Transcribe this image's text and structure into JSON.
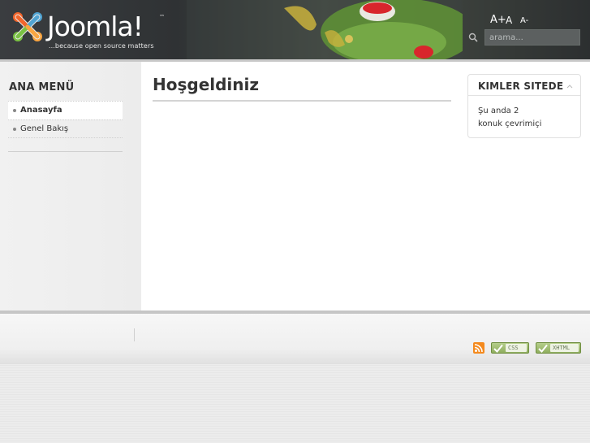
{
  "header": {
    "logo": {
      "wordmark": "Joomla!",
      "trademark": "™",
      "tagline": "...because open source matters"
    },
    "font_sizer": {
      "larger": "A+",
      "normal": "A",
      "smaller": "A-"
    },
    "search": {
      "placeholder": "arama...",
      "icon": "search-icon"
    }
  },
  "sidebar": {
    "title": "ANA MENÜ",
    "items": [
      {
        "label": "Anasayfa",
        "active": true
      },
      {
        "label": "Genel Bakış",
        "active": false
      }
    ]
  },
  "main": {
    "title": "Hoşgeldiniz"
  },
  "who_online": {
    "title": "KIMLER SITEDE",
    "line1": "Şu anda 2",
    "line2": "konuk çevrimiçi"
  },
  "footer": {
    "badges": {
      "rss": "rss-icon",
      "css": "CSS",
      "xhtml": "XHTML"
    }
  },
  "colors": {
    "header_bg": "#2f3234",
    "frog_green": "#6aa03a",
    "accent_red": "#d8262c",
    "badge_green": "#8fae5f"
  }
}
